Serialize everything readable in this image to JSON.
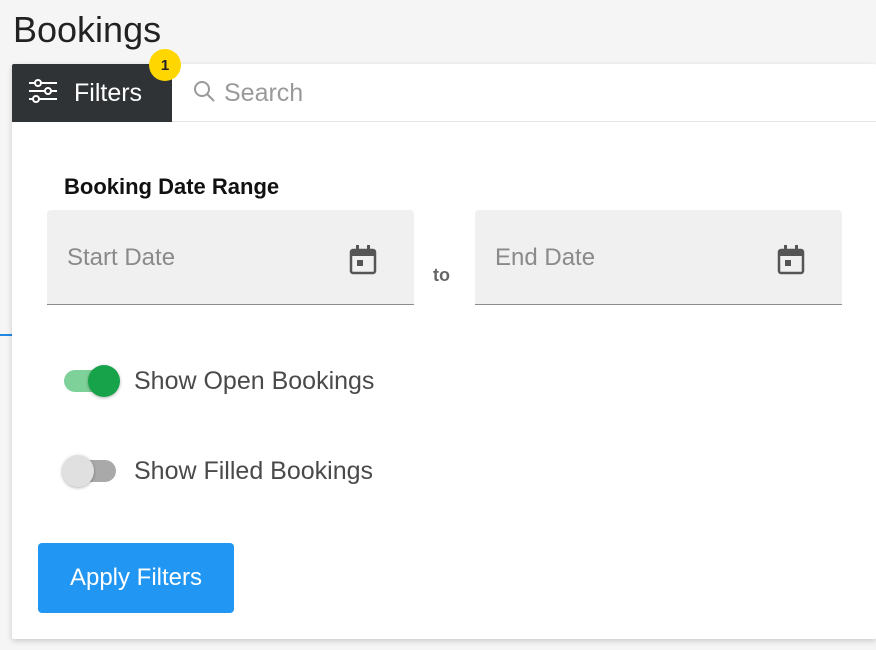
{
  "page": {
    "title": "Bookings"
  },
  "toolbar": {
    "filters_label": "Filters",
    "filters_badge": "1",
    "search_placeholder": "Search"
  },
  "filters": {
    "date_range_title": "Booking Date Range",
    "start_placeholder": "Start Date",
    "end_placeholder": "End Date",
    "to_label": "to",
    "toggles": [
      {
        "label": "Show Open Bookings",
        "on": true
      },
      {
        "label": "Show Filled Bookings",
        "on": false
      }
    ],
    "apply_label": "Apply Filters"
  },
  "icons": {
    "filter": "sliders-icon",
    "search": "search-icon",
    "calendar": "calendar-icon"
  },
  "colors": {
    "toolbar_dark": "#2f3336",
    "badge": "#ffd600",
    "primary": "#2196f3",
    "toggle_on": "#16a34a"
  }
}
